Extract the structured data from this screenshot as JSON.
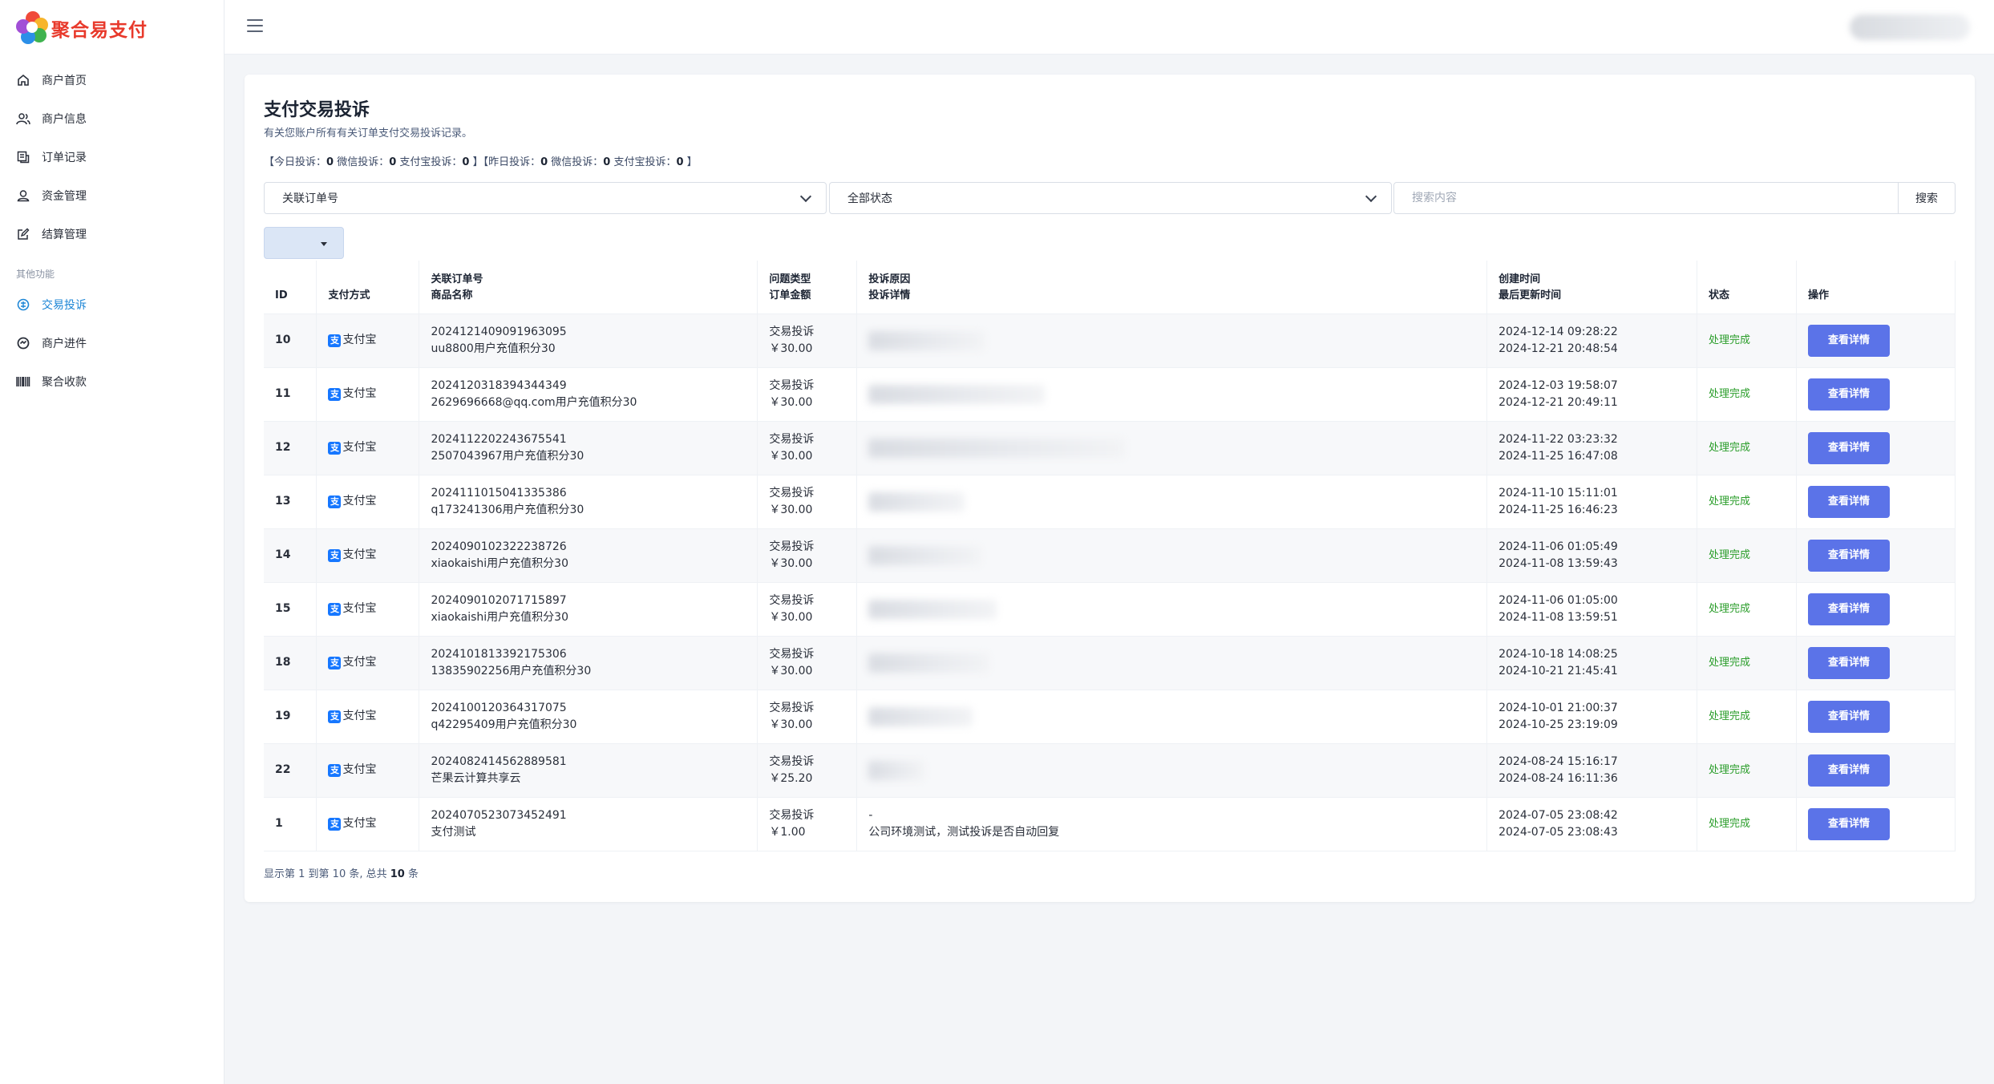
{
  "app": {
    "logo_text": "聚合易支付"
  },
  "sidebar": {
    "items": [
      {
        "label": "商户首页",
        "icon": "home-icon"
      },
      {
        "label": "商户信息",
        "icon": "users-icon"
      },
      {
        "label": "订单记录",
        "icon": "receipt-icon"
      },
      {
        "label": "资金管理",
        "icon": "wallet-icon"
      },
      {
        "label": "结算管理",
        "icon": "edit-icon"
      }
    ],
    "section": "其他功能",
    "items2": [
      {
        "label": "交易投诉",
        "icon": "complaint-icon"
      },
      {
        "label": "商户进件",
        "icon": "onboard-icon"
      },
      {
        "label": "聚合收款",
        "icon": "barcode-icon"
      }
    ],
    "active": "交易投诉"
  },
  "page": {
    "title": "支付交易投诉",
    "subtitle": "有关您账户所有有关订单支付交易投诉记录。",
    "stats": {
      "today_label": "【今日投诉：",
      "today": "0",
      "today_wx_label": " 微信投诉：",
      "today_wx": "0",
      "today_ali_label": " 支付宝投诉：",
      "today_ali": "0",
      "mid": " 】【昨日投诉：",
      "yest": "0",
      "yest_wx_label": " 微信投诉：",
      "yest_wx": "0",
      "yest_ali_label": " 支付宝投诉：",
      "yest_ali": "0",
      "end": " 】"
    }
  },
  "filters": {
    "order_select": "关联订单号",
    "status_select": "全部状态",
    "search_placeholder": "搜索内容",
    "search_button": "搜索"
  },
  "table": {
    "headers": {
      "id": "ID",
      "pay": "支付方式",
      "order_1": "关联订单号",
      "order_2": "商品名称",
      "type_1": "问题类型",
      "type_2": "订单金额",
      "reason_1": "投诉原因",
      "reason_2": "投诉详情",
      "time_1": "创建时间",
      "time_2": "最后更新时间",
      "status": "状态",
      "action": "操作"
    },
    "rows": [
      {
        "id": "10",
        "pay": "支付宝",
        "order": "2024121409091963095",
        "product": "uu8800用户充值积分30",
        "type": "交易投诉",
        "amount": "￥30.00",
        "created": "2024-12-14 09:28:22",
        "updated": "2024-12-21 20:48:54",
        "status": "处理完成",
        "action": "查看详情",
        "blur_w": 145
      },
      {
        "id": "11",
        "pay": "支付宝",
        "order": "2024120318394344349",
        "product": "2629696668@qq.com用户充值积分30",
        "type": "交易投诉",
        "amount": "￥30.00",
        "created": "2024-12-03 19:58:07",
        "updated": "2024-12-21 20:49:11",
        "status": "处理完成",
        "action": "查看详情",
        "blur_w": 220
      },
      {
        "id": "12",
        "pay": "支付宝",
        "order": "2024112202243675541",
        "product": "2507043967用户充值积分30",
        "type": "交易投诉",
        "amount": "￥30.00",
        "created": "2024-11-22 03:23:32",
        "updated": "2024-11-25 16:47:08",
        "status": "处理完成",
        "action": "查看详情",
        "blur_w": 320
      },
      {
        "id": "13",
        "pay": "支付宝",
        "order": "2024111015041335386",
        "product": "q173241306用户充值积分30",
        "type": "交易投诉",
        "amount": "￥30.00",
        "created": "2024-11-10 15:11:01",
        "updated": "2024-11-25 16:46:23",
        "status": "处理完成",
        "action": "查看详情",
        "blur_w": 120
      },
      {
        "id": "14",
        "pay": "支付宝",
        "order": "2024090102322238726",
        "product": "xiaokaishi用户充值积分30",
        "type": "交易投诉",
        "amount": "￥30.00",
        "created": "2024-11-06 01:05:49",
        "updated": "2024-11-08 13:59:43",
        "status": "处理完成",
        "action": "查看详情",
        "blur_w": 140
      },
      {
        "id": "15",
        "pay": "支付宝",
        "order": "2024090102071715897",
        "product": "xiaokaishi用户充值积分30",
        "type": "交易投诉",
        "amount": "￥30.00",
        "created": "2024-11-06 01:05:00",
        "updated": "2024-11-08 13:59:51",
        "status": "处理完成",
        "action": "查看详情",
        "blur_w": 160
      },
      {
        "id": "18",
        "pay": "支付宝",
        "order": "2024101813392175306",
        "product": "13835902256用户充值积分30",
        "type": "交易投诉",
        "amount": "￥30.00",
        "created": "2024-10-18 14:08:25",
        "updated": "2024-10-21 21:45:41",
        "status": "处理完成",
        "action": "查看详情",
        "blur_w": 150
      },
      {
        "id": "19",
        "pay": "支付宝",
        "order": "2024100120364317075",
        "product": "q42295409用户充值积分30",
        "type": "交易投诉",
        "amount": "￥30.00",
        "created": "2024-10-01 21:00:37",
        "updated": "2024-10-25 23:19:09",
        "status": "处理完成",
        "action": "查看详情",
        "blur_w": 130
      },
      {
        "id": "22",
        "pay": "支付宝",
        "order": "2024082414562889581",
        "product": "芒果云计算共享云",
        "type": "交易投诉",
        "amount": "￥25.20",
        "created": "2024-08-24 15:16:17",
        "updated": "2024-08-24 16:11:36",
        "status": "处理完成",
        "action": "查看详情",
        "blur_w": 70
      },
      {
        "id": "1",
        "pay": "支付宝",
        "order": "2024070523073452491",
        "product": "支付测试",
        "type": "交易投诉",
        "amount": "￥1.00",
        "reason": "-",
        "detail": "公司环境测试，测试投诉是否自动回复",
        "created": "2024-07-05 23:08:42",
        "updated": "2024-07-05 23:08:43",
        "status": "处理完成",
        "action": "查看详情",
        "blur_w": 0
      }
    ]
  },
  "footer": {
    "pre": "显示第 1 到第 10 条, 总共 ",
    "total": "10",
    "post": " 条"
  },
  "colors": {
    "accent": "#5b73e8",
    "active_nav": "#1d86d6",
    "status_ok": "#2a9d2a",
    "alipay": "#1677ff",
    "logo": "#e8392b"
  }
}
